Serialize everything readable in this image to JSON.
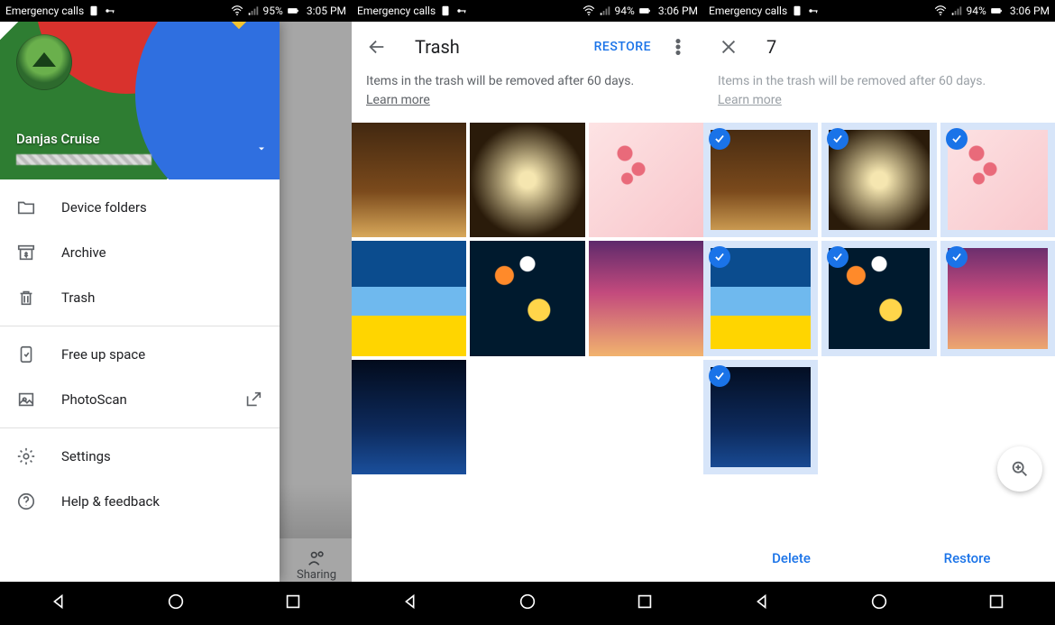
{
  "status": {
    "carrier": "Emergency calls ",
    "battery1": "95%",
    "battery2": "94%",
    "battery3": "94%",
    "time1": "3:05 PM",
    "time2": "3:06 PM",
    "time3": "3:06 PM"
  },
  "screen1": {
    "user_name": "Danjas Cruise",
    "menu": {
      "device_folders": "Device folders",
      "archive": "Archive",
      "trash": "Trash",
      "free_up_space": "Free up space",
      "photoscan": "PhotoScan",
      "settings": "Settings",
      "help": "Help & feedback"
    },
    "sharing_tab": "Sharing"
  },
  "screen2": {
    "title": "Trash",
    "restore_action": "RESTORE",
    "note": "Items in the trash will be removed after 60 days.",
    "learn_more": "Learn more"
  },
  "screen3": {
    "count": "7",
    "note": "Items in the trash will be removed after 60 days.",
    "learn_more": "Learn more",
    "delete": "Delete",
    "restore": "Restore"
  }
}
